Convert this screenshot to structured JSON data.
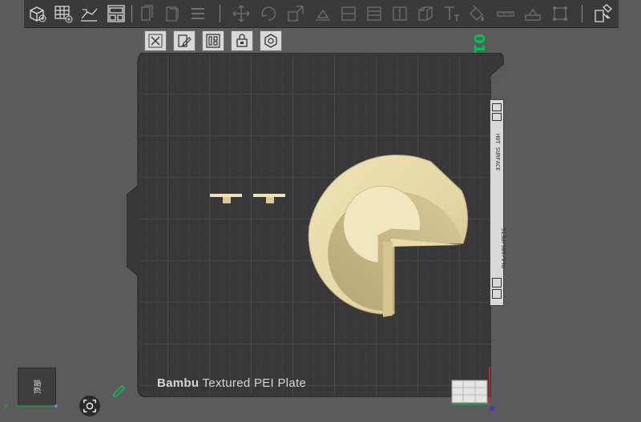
{
  "toolbar": {
    "buttons": [
      {
        "name": "add-object",
        "icon": "cube-plus-icon"
      },
      {
        "name": "add-plate",
        "icon": "grid-plus-icon"
      },
      {
        "name": "auto-orient",
        "icon": "orient-icon"
      },
      {
        "name": "arrange",
        "icon": "arrange-icon"
      },
      {
        "name": "copy",
        "icon": "copy-icon"
      },
      {
        "name": "paste",
        "icon": "paste-icon"
      },
      {
        "name": "delete",
        "icon": "delete-icon"
      },
      {
        "name": "move",
        "icon": "move-icon"
      },
      {
        "name": "rotate",
        "icon": "rotate-icon"
      },
      {
        "name": "scale",
        "icon": "scale-icon"
      },
      {
        "name": "lay-on-face",
        "icon": "lay-on-face-icon"
      },
      {
        "name": "cut",
        "icon": "cut-icon"
      },
      {
        "name": "variable-layer",
        "icon": "variable-layer-icon"
      },
      {
        "name": "support-paint",
        "icon": "support-paint-icon"
      },
      {
        "name": "seam-paint",
        "icon": "seam-icon"
      },
      {
        "name": "text",
        "icon": "text-icon"
      },
      {
        "name": "color-paint",
        "icon": "paint-bucket-icon"
      },
      {
        "name": "measure",
        "icon": "measure-icon"
      },
      {
        "name": "assembly",
        "icon": "assembly-icon"
      },
      {
        "name": "boolean",
        "icon": "boolean-icon"
      },
      {
        "name": "view-mode",
        "icon": "view-mode-icon"
      }
    ]
  },
  "plate_tools": [
    {
      "name": "delete-plate",
      "icon": "close-icon"
    },
    {
      "name": "settings-plate",
      "icon": "edit-icon"
    },
    {
      "name": "arrange-plate",
      "icon": "arrange-plate-icon"
    },
    {
      "name": "lock-plate",
      "icon": "lock-icon"
    },
    {
      "name": "plate-type",
      "icon": "hex-icon"
    }
  ],
  "plate": {
    "number": "01",
    "label_brand": "Bambu",
    "label_name": "Textured PEI Plate",
    "side_strip_top": "HOT SURFACE",
    "side_strip_bottom": "PLA/ABS/PETG"
  },
  "nav_cube": {
    "face": "顶部",
    "axis_y": "y"
  },
  "colors": {
    "bed": "#3b3b3d",
    "grid": "#4d4d50",
    "model": "#e8dcaa",
    "accent_green": "#00c74c"
  }
}
